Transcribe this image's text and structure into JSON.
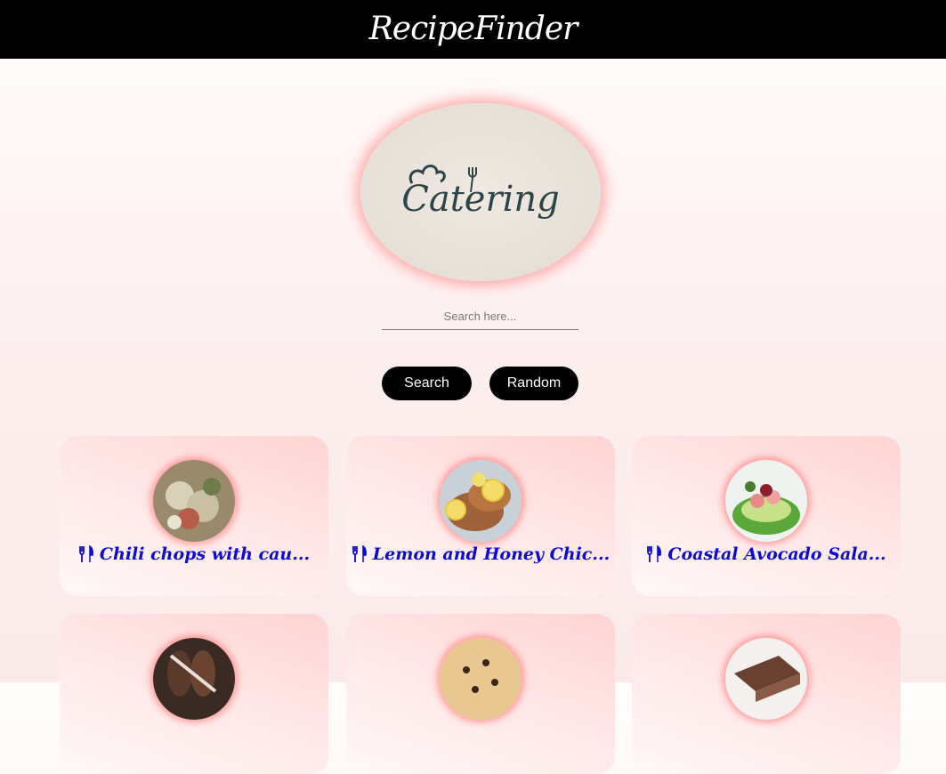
{
  "header": {
    "brand": "RecipeFinder"
  },
  "logo": {
    "text": "Catering",
    "icon": "chef-hat-fork-icon"
  },
  "search": {
    "placeholder": "Search here...",
    "value": ""
  },
  "buttons": {
    "search": "Search",
    "random": "Random"
  },
  "recipes": [
    {
      "title": "Chili chops with cau...",
      "icon": "utensils-icon"
    },
    {
      "title": "Lemon and Honey Chic...",
      "icon": "utensils-icon"
    },
    {
      "title": "Coastal Avocado Sala...",
      "icon": "utensils-icon"
    },
    {
      "title": "",
      "icon": "utensils-icon"
    },
    {
      "title": "",
      "icon": "utensils-icon"
    },
    {
      "title": "",
      "icon": "utensils-icon"
    }
  ],
  "colors": {
    "header_bg": "#000000",
    "accent_title": "#0a0ad8",
    "button_bg": "#000000",
    "glow": "#ff7878"
  }
}
